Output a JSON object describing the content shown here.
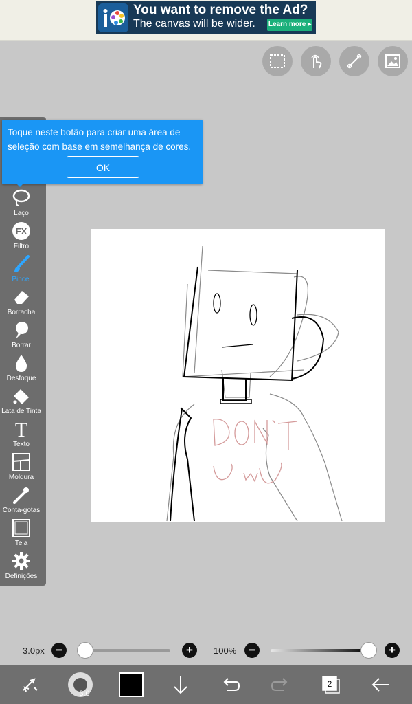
{
  "ad": {
    "title": "You want to remove the Ad?",
    "subtitle": "The canvas will be wider.",
    "button": "Learn more ▸"
  },
  "tooltip": {
    "text": "Toque neste botão para criar uma área de seleção com base em semelhança de cores.",
    "ok": "OK"
  },
  "tools": [
    {
      "label": "Laço",
      "icon": "lasso-icon"
    },
    {
      "label": "Filtro",
      "icon": "fx-icon"
    },
    {
      "label": "Pincel",
      "icon": "brush-icon",
      "active": true
    },
    {
      "label": "Borracha",
      "icon": "eraser-icon"
    },
    {
      "label": "Borrar",
      "icon": "smudge-icon"
    },
    {
      "label": "Desfoque",
      "icon": "blur-drop-icon"
    },
    {
      "label": "Lata de Tinta",
      "icon": "paint-bucket-icon"
    },
    {
      "label": "Texto",
      "icon": "text-icon"
    },
    {
      "label": "Moldura",
      "icon": "frame-icon"
    },
    {
      "label": "Conta-gotas",
      "icon": "eyedropper-icon"
    },
    {
      "label": "Tela",
      "icon": "canvas-icon"
    },
    {
      "label": "Definições",
      "icon": "gear-icon"
    }
  ],
  "canvas_text": {
    "line1": "DON'T",
    "line2": "UwU"
  },
  "brush": {
    "size_label": "3.0px",
    "size_fraction": 0.0,
    "opacity_label": "100%",
    "opacity_fraction": 1.0,
    "preview_size": "3.0"
  },
  "layers": {
    "count": "2"
  },
  "colors": {
    "accent": "#1a96f5",
    "current_color": "#000000"
  }
}
